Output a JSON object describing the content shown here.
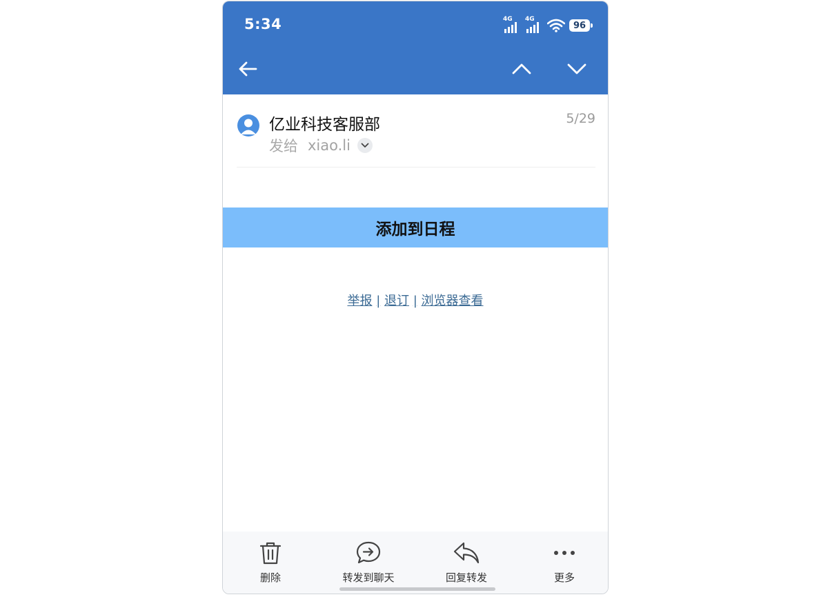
{
  "status_bar": {
    "time": "5:34",
    "signal1_label": "4G",
    "signal2_label": "4G",
    "battery_level": "96"
  },
  "toolbar": {
    "back_icon": "arrow-left-icon",
    "prev_icon": "chevron-up-icon",
    "next_icon": "chevron-down-icon"
  },
  "mail": {
    "sender": "亿业科技客服部",
    "date": "5/29",
    "to_label": "发给",
    "recipient": "xiao.li"
  },
  "body": {
    "cta_label": "添加到日程",
    "links": [
      {
        "label": "举报"
      },
      {
        "label": "退订"
      },
      {
        "label": "浏览器查看"
      }
    ],
    "link_separator": "|"
  },
  "bottom_actions": [
    {
      "label": "删除",
      "icon": "trash-icon"
    },
    {
      "label": "转发到聊天",
      "icon": "forward-chat-icon"
    },
    {
      "label": "回复转发",
      "icon": "reply-icon"
    },
    {
      "label": "更多",
      "icon": "more-icon"
    }
  ],
  "colors": {
    "header_blue": "#3a76c7",
    "cta_blue": "#7bbdfb",
    "link_blue": "#3b6a94"
  }
}
